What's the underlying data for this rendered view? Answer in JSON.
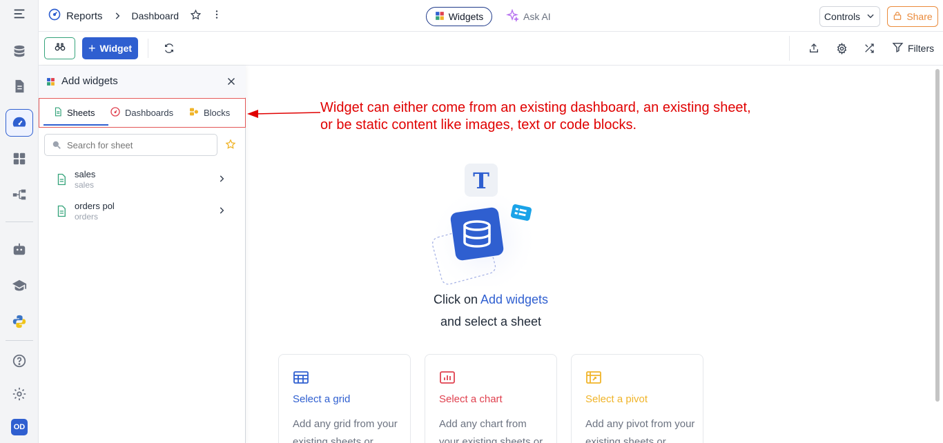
{
  "topbar": {
    "reports_label": "Reports",
    "dashboard_label": "Dashboard",
    "widgets_label": "Widgets",
    "ask_ai_label": "Ask AI",
    "controls_label": "Controls",
    "share_label": "Share"
  },
  "toolbar": {
    "add_widget_label": "Widget",
    "filters_label": "Filters"
  },
  "panel": {
    "title": "Add widgets",
    "tabs": [
      {
        "label": "Sheets"
      },
      {
        "label": "Dashboards"
      },
      {
        "label": "Blocks"
      }
    ],
    "search_placeholder": "Search for sheet",
    "items": [
      {
        "name": "sales",
        "sub": "sales"
      },
      {
        "name": "orders pol",
        "sub": "orders"
      }
    ]
  },
  "annotation": {
    "line1": "Widget can either come from an existing dashboard, an existing sheet,",
    "line2": "or be static content like images, text or code blocks."
  },
  "empty_state": {
    "prefix": "Click on ",
    "link": "Add widgets",
    "line2": "and select a sheet",
    "art_letter": "T"
  },
  "cards": [
    {
      "title": "Select a grid",
      "desc": "Add any grid from your existing sheets or",
      "color": "#2f5fd0"
    },
    {
      "title": "Select a chart",
      "desc": "Add any chart from your existing sheets or",
      "color": "#e0414f"
    },
    {
      "title": "Select a pivot",
      "desc": "Add any pivot from your existing sheets or",
      "color": "#f0b429"
    }
  ],
  "rail": {
    "avatar_initials": "OD",
    "icons": [
      "menu-icon",
      "database-icon",
      "document-icon",
      "dashboard-icon",
      "grid-icon",
      "flow-icon",
      "bot-icon",
      "graduation-cap-icon",
      "python-icon",
      "help-icon",
      "gear-icon"
    ]
  },
  "colors": {
    "accent": "#2f5fd0",
    "share": "#ea8a3a",
    "annotation": "#e00000",
    "sheet_icon": "#34a37a"
  }
}
